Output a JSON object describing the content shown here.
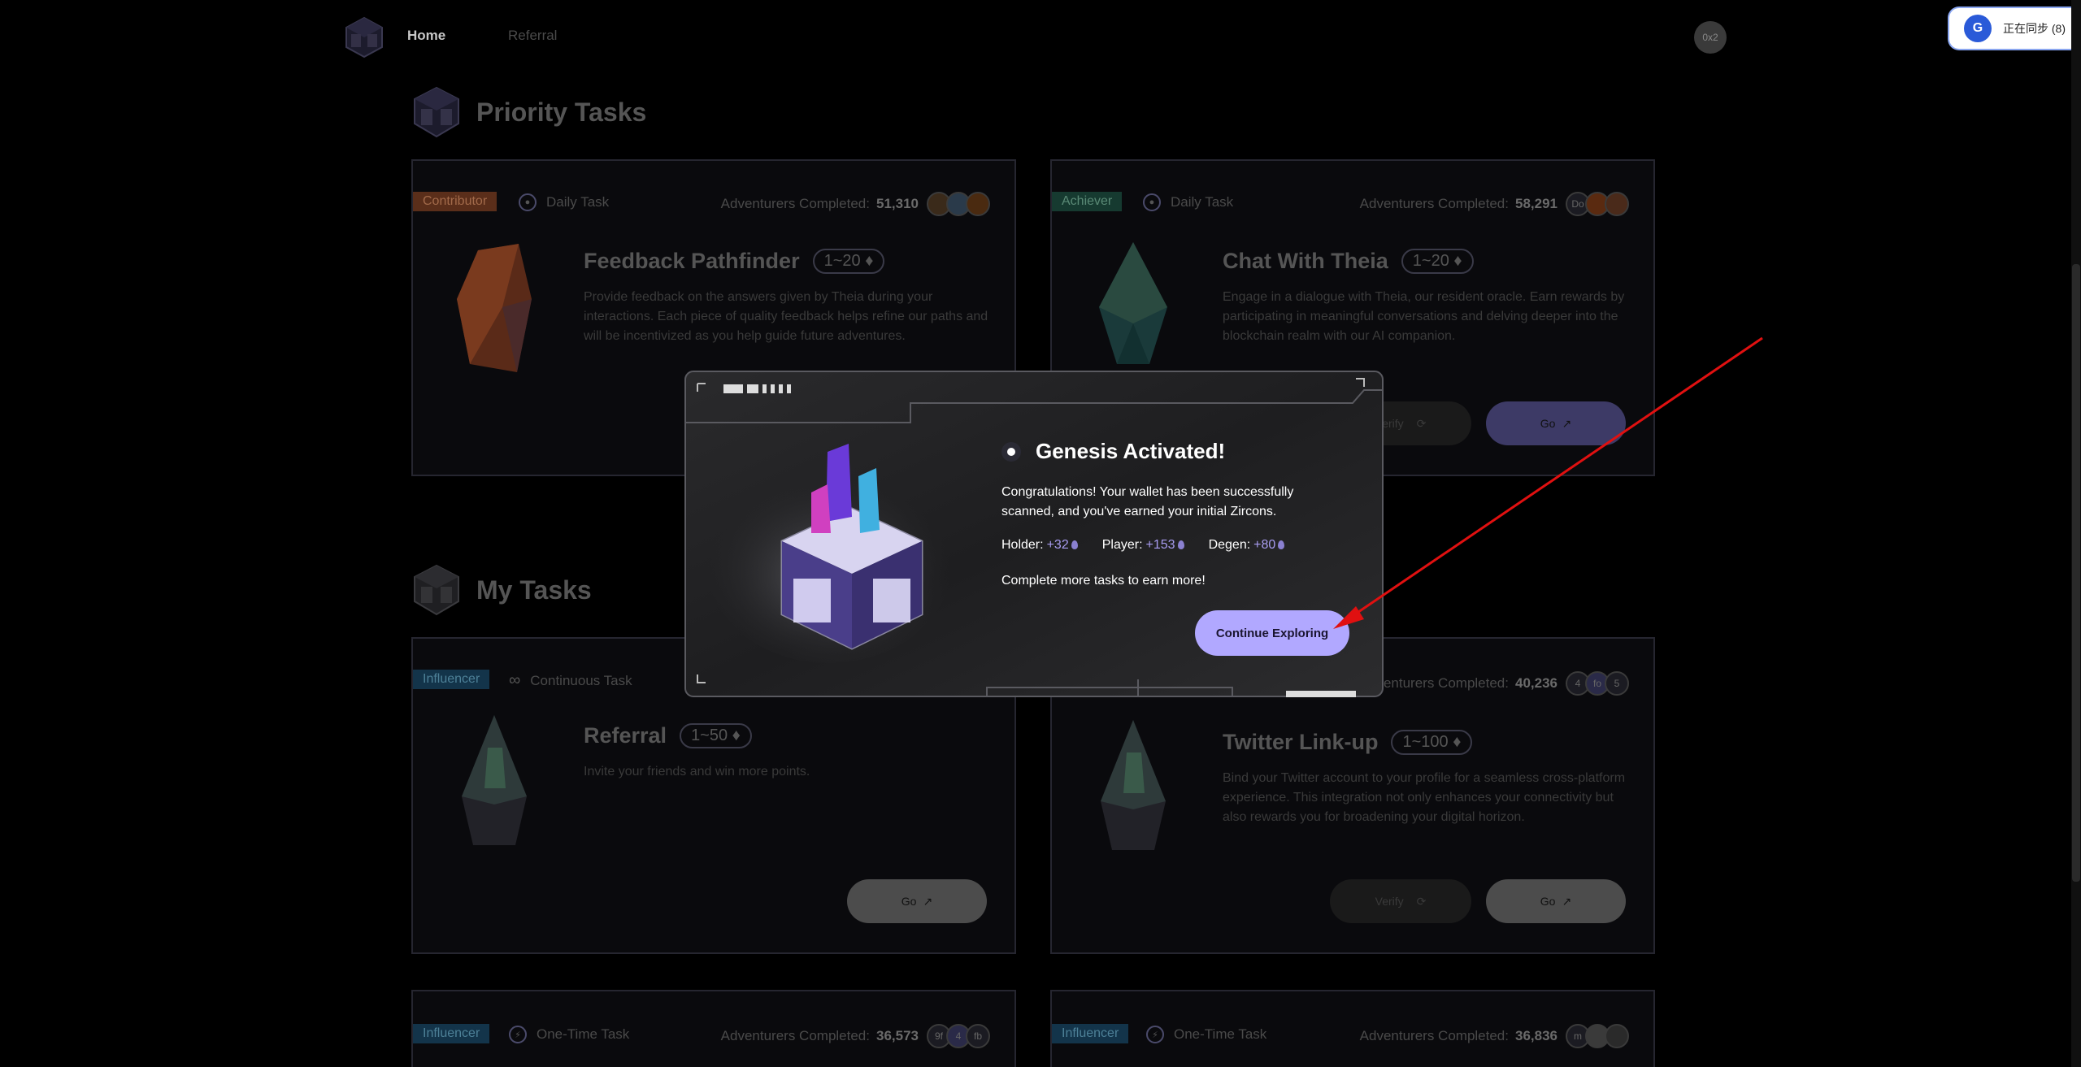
{
  "nav": {
    "home": "Home",
    "referral": "Referral",
    "wallet": "0x2"
  },
  "sync": {
    "label": "正在同步 (8)"
  },
  "sections": {
    "priority": "Priority Tasks",
    "my": "My Tasks"
  },
  "cards": [
    {
      "tag": "Contributor",
      "type": "Daily Task",
      "adv_label": "Adventurers Completed:",
      "adv_count": "51,310",
      "title": "Feedback Pathfinder",
      "points": "1~20",
      "desc": "Provide feedback on the answers given by Theia during your interactions. Each piece of quality feedback helps refine our paths and will be incentivized as you help guide future adventures.",
      "avatars": [
        "",
        "",
        ""
      ]
    },
    {
      "tag": "Achiever",
      "type": "Daily Task",
      "adv_label": "Adventurers Completed:",
      "adv_count": "58,291",
      "title": "Chat With Theia",
      "points": "1~20",
      "desc": "Engage in a dialogue with Theia, our resident oracle. Earn rewards by participating in meaningful conversations and delving deeper into the blockchain realm with our AI companion.",
      "verify": "Verify",
      "go": "Go",
      "avatars": [
        "Do",
        "",
        ""
      ]
    },
    {
      "tag": "Influencer",
      "type": "Continuous Task",
      "title": "Referral",
      "points": "1~50",
      "desc": "Invite your friends and win more points.",
      "go": "Go"
    },
    {
      "tag": "",
      "type": "",
      "adv_label": "Adventurers Completed:",
      "adv_count": "40,236",
      "title": "Twitter Link-up",
      "points": "1~100",
      "desc": "Bind your Twitter account to your profile for a seamless cross-platform experience. This integration not only enhances your connectivity but also rewards you for broadening your digital horizon.",
      "verify": "Verify",
      "go": "Go",
      "avatars": [
        "4",
        "fo",
        "5"
      ]
    },
    {
      "tag": "Influencer",
      "type": "One-Time Task",
      "adv_label": "Adventurers Completed:",
      "adv_count": "36,573",
      "avatars": [
        "9f",
        "4",
        "fb"
      ]
    },
    {
      "tag": "Influencer",
      "type": "One-Time Task",
      "adv_label": "Adventurers Completed:",
      "adv_count": "36,836",
      "avatars": [
        "m",
        "",
        ""
      ]
    }
  ],
  "modal": {
    "title": "Genesis Activated!",
    "desc": "Congratulations! Your wallet has been successfully scanned, and you've earned your initial Zircons.",
    "holder_label": "Holder:",
    "holder_value": "+32",
    "player_label": "Player:",
    "player_value": "+153",
    "degen_label": "Degen:",
    "degen_value": "+80",
    "more": "Complete more tasks to earn more!",
    "button": "Continue Exploring"
  },
  "colors": {
    "accent": "#b1a8ff",
    "arrow": "#e01010"
  }
}
